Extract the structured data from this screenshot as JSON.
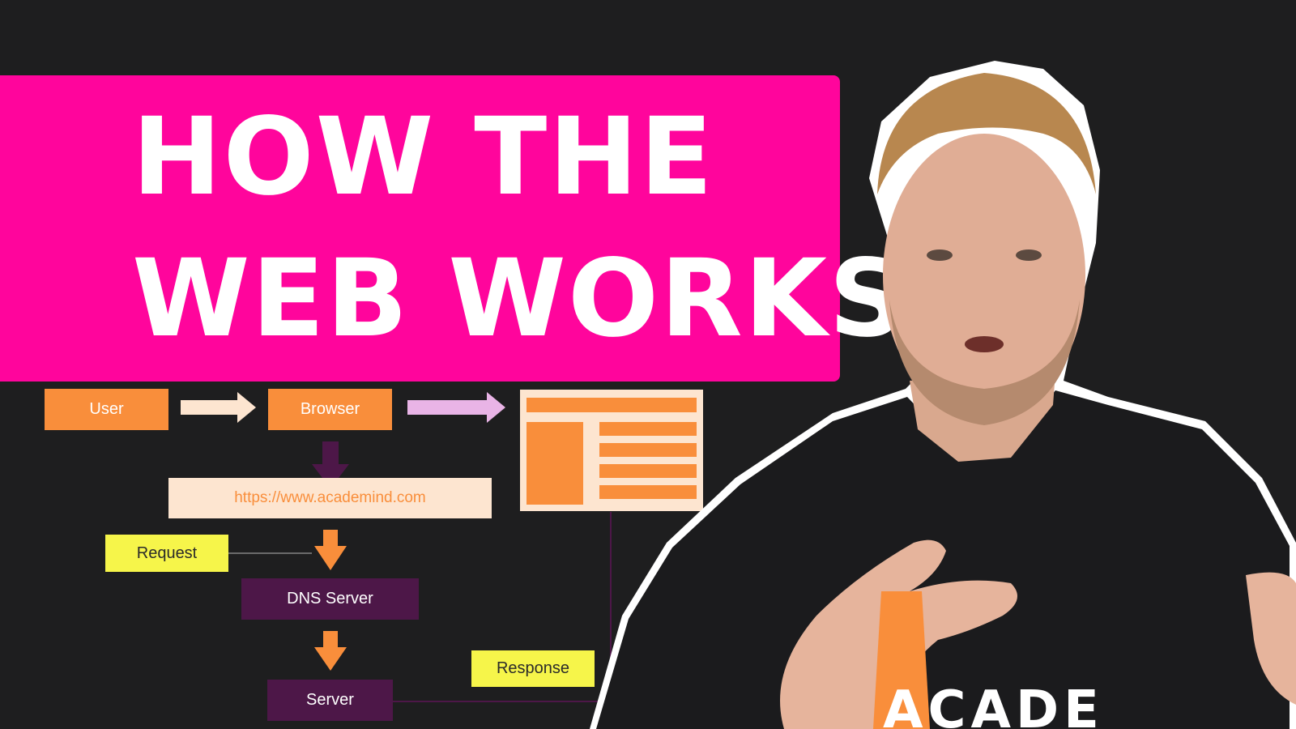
{
  "title": {
    "line1": "HOW THE",
    "line2": "WEB WORKS"
  },
  "diagram": {
    "user": "User",
    "browser": "Browser",
    "url": "https://www.academind.com",
    "request": "Request",
    "dns_server": "DNS Server",
    "response": "Response",
    "server": "Server"
  },
  "shirt_logo_text": "ACADE",
  "colors": {
    "banner": "#ff059c",
    "background": "#1e1e1f",
    "orange": "#f98e3b",
    "yellow": "#f6f54a",
    "purple": "#4d1748",
    "url_bg": "#fde5d0"
  }
}
